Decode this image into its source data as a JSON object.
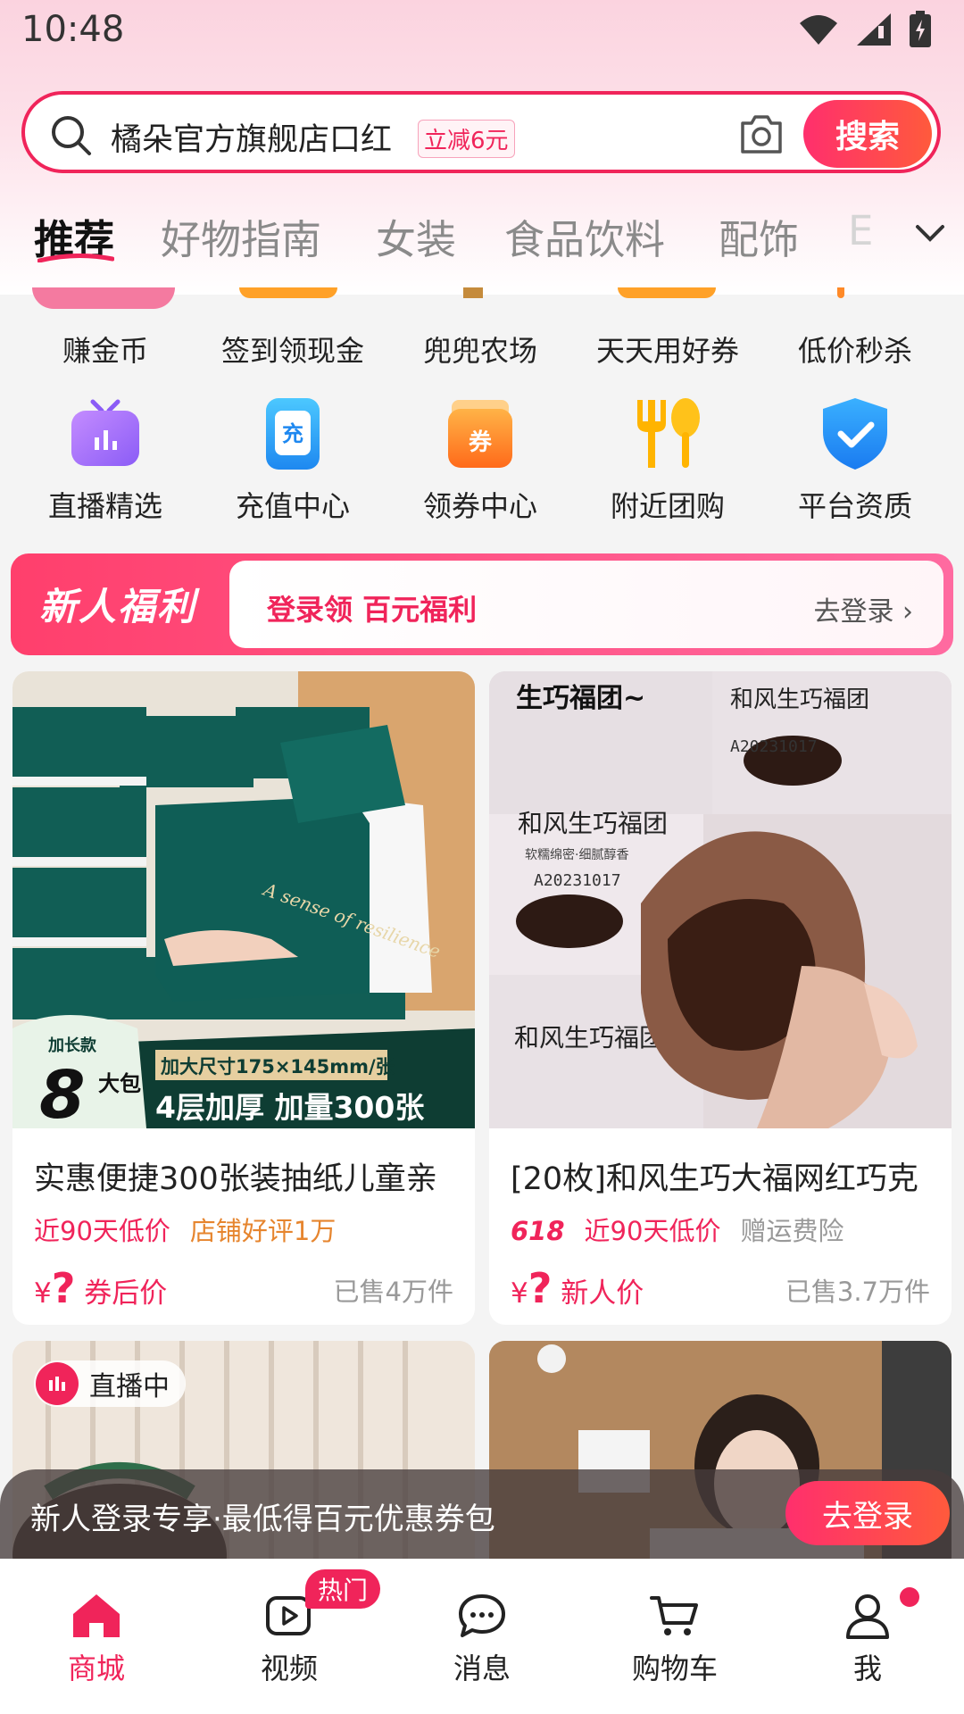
{
  "status_bar": {
    "time": "10:48"
  },
  "search": {
    "query": "橘朵官方旗舰店口红",
    "promo_tag": "立减6元",
    "button": "搜索"
  },
  "tabs": [
    {
      "label": "推荐",
      "active": true
    },
    {
      "label": "好物指南"
    },
    {
      "label": "女装"
    },
    {
      "label": "食品饮料"
    },
    {
      "label": "配饰"
    },
    {
      "label": "E"
    }
  ],
  "grid_row1": [
    {
      "label": "赚金币"
    },
    {
      "label": "签到领现金"
    },
    {
      "label": "兜兜农场"
    },
    {
      "label": "天天用好券"
    },
    {
      "label": "低价秒杀"
    }
  ],
  "grid_row2": [
    {
      "label": "直播精选",
      "icon": "tv-icon"
    },
    {
      "label": "充值中心",
      "icon": "recharge-icon",
      "glyph": "充"
    },
    {
      "label": "领券中心",
      "icon": "coupon-icon",
      "glyph": "券"
    },
    {
      "label": "附近团购",
      "icon": "fork-spoon-icon"
    },
    {
      "label": "平台资质",
      "icon": "shield-check-icon"
    }
  ],
  "newbie": {
    "title": "新人福利",
    "text": "登录领 百元福利",
    "login": "去登录"
  },
  "products": [
    {
      "title": "实惠便捷300张装抽纸儿童亲",
      "tags": [
        "近90天低价",
        "店铺好评1万"
      ],
      "price_symbol": "¥",
      "price": "?",
      "price_label": "券后价",
      "sold": "已售4万件",
      "image_text": {
        "top": "加长款",
        "count": "8",
        "unit": "大包",
        "line1": "加大尺寸175×145mm/张",
        "line2": "4层加厚 加量300张",
        "brand": "A sense of resilience"
      }
    },
    {
      "title": "[20枚]和风生巧大福网红巧克",
      "badge_618": "618",
      "tags": [
        "近90天低价",
        "赠运费险"
      ],
      "price_symbol": "¥",
      "price": "?",
      "price_label": "新人价",
      "sold": "已售3.7万件",
      "image_text": {
        "caption": "生巧福团~",
        "pack_name": "和风生巧福团",
        "pack_sub": "软糯绵密·细腻醇香",
        "pack_code": "A20231017"
      }
    }
  ],
  "live_badge": "直播中",
  "login_bar": {
    "text": "新人登录专享·最低得百元优惠券包",
    "button": "去登录"
  },
  "bottom_nav": [
    {
      "label": "商城",
      "icon": "home-icon",
      "active": true
    },
    {
      "label": "视频",
      "icon": "video-icon",
      "badge": "热门"
    },
    {
      "label": "消息",
      "icon": "chat-icon"
    },
    {
      "label": "购物车",
      "icon": "cart-icon"
    },
    {
      "label": "我",
      "icon": "user-icon",
      "dot": true
    }
  ],
  "colors": {
    "accent": "#f0245a",
    "header": "#fde2ea"
  }
}
